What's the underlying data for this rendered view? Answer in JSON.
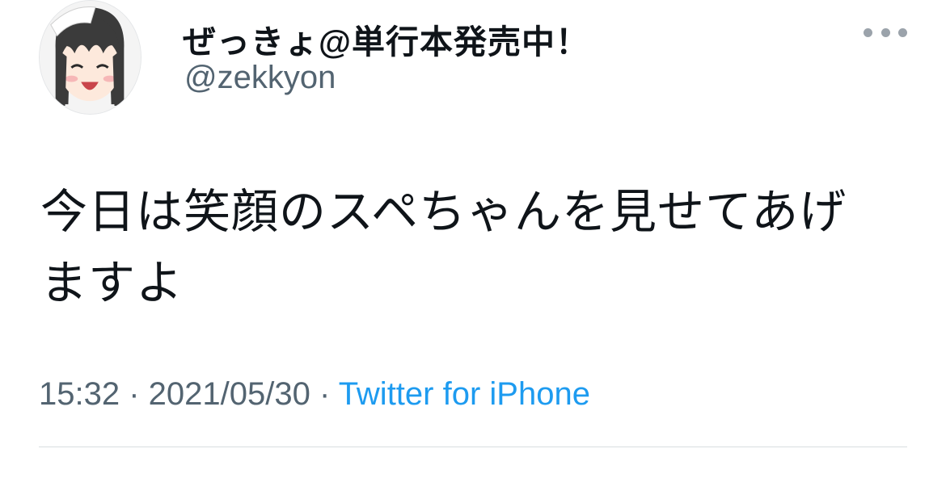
{
  "author": {
    "display_name": "ぜっきょ@単行本発売中！",
    "handle": "@zekkyon",
    "avatar_icon": "anime-character-avatar-icon"
  },
  "more_icon": "more-horizontal-icon",
  "tweet": {
    "line1": "今日は笑顔のスペちゃんを見せてあげ",
    "line2": "ますよ"
  },
  "meta": {
    "time": "15:32",
    "separator": " · ",
    "date": "2021/05/30",
    "source": "Twitter for iPhone"
  },
  "colors": {
    "text": "#0f1419",
    "secondary": "#536471",
    "link": "#1d9bf0",
    "divider": "#d9dde0"
  }
}
